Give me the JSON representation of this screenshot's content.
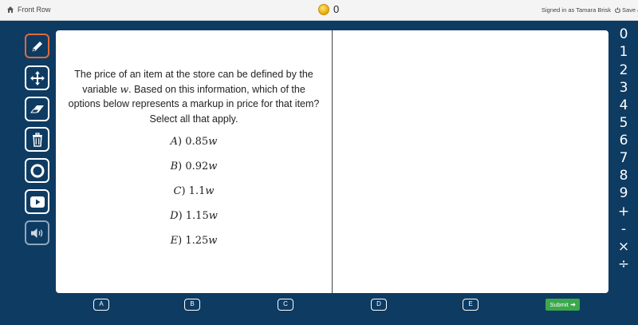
{
  "topbar": {
    "front_row": "Front Row",
    "coin_count": "0",
    "signed_in": "Signed in as Tamara Brisk",
    "save": "Save &"
  },
  "toolbar": {
    "tools": [
      "pencil-icon",
      "move-icon",
      "eraser-icon",
      "trash-icon",
      "circle-icon",
      "play-icon",
      "speaker-icon"
    ]
  },
  "question": {
    "line1": "The price of an item at the store can be defined by the",
    "line2a": "variable ",
    "var": "w",
    "line2b": ". Based on this information, which of the",
    "line3": "options below represents a markup in price for that item?",
    "line4": "Select all that apply."
  },
  "options": [
    {
      "label": "A",
      "value": "0.85"
    },
    {
      "label": "B",
      "value": "0.92"
    },
    {
      "label": "C",
      "value": "1.1"
    },
    {
      "label": "D",
      "value": "1.15"
    },
    {
      "label": "E",
      "value": "1.25"
    }
  ],
  "keypad": [
    "0",
    "1",
    "2",
    "3",
    "4",
    "5",
    "6",
    "7",
    "8",
    "9",
    "+",
    "-",
    "×",
    "÷"
  ],
  "answers": [
    "A",
    "B",
    "C",
    "D",
    "E"
  ],
  "submit": "Submit"
}
